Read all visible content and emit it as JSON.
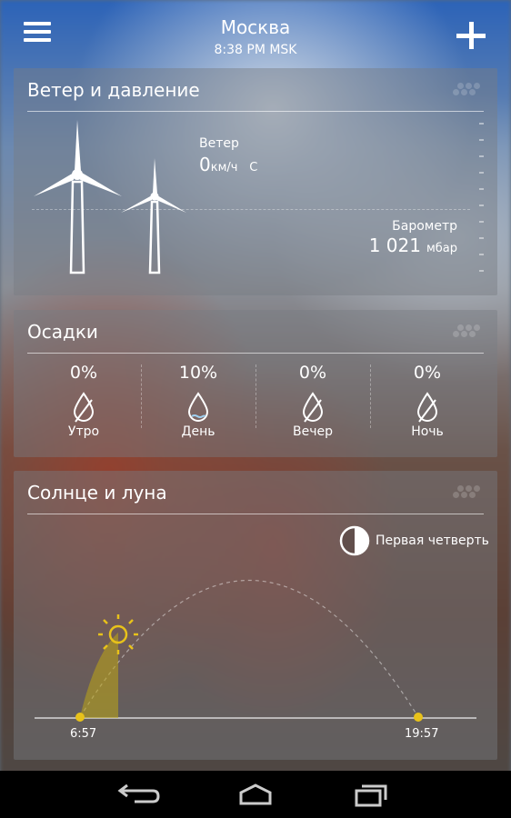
{
  "header": {
    "city": "Москва",
    "time": "8:38 PM MSK",
    "menu_icon": "menu-icon",
    "add_icon": "plus-icon"
  },
  "wind_card": {
    "title": "Ветер и давление",
    "wind_label": "Ветер",
    "wind_value": "0",
    "wind_unit": "км/ч",
    "wind_direction": "С",
    "barometer_label": "Барометр",
    "barometer_value": "1 021",
    "barometer_unit": "мбар"
  },
  "precip_card": {
    "title": "Осадки",
    "periods": [
      {
        "percent": "0%",
        "label": "Утро",
        "icon": "no-rain-drop-icon"
      },
      {
        "percent": "10%",
        "label": "День",
        "icon": "rain-drop-icon"
      },
      {
        "percent": "0%",
        "label": "Вечер",
        "icon": "no-rain-drop-icon"
      },
      {
        "percent": "0%",
        "label": "Ночь",
        "icon": "no-rain-drop-icon"
      }
    ]
  },
  "sun_card": {
    "title": "Солнце и луна",
    "moon_phase": "Первая четверть",
    "sunrise": "6:57",
    "sunset": "19:57",
    "sun_icon": "sun-icon",
    "accent_color": "#e8c21a"
  },
  "navbar": {
    "back_icon": "back-icon",
    "home_icon": "home-icon",
    "recents_icon": "recent-apps-icon"
  }
}
